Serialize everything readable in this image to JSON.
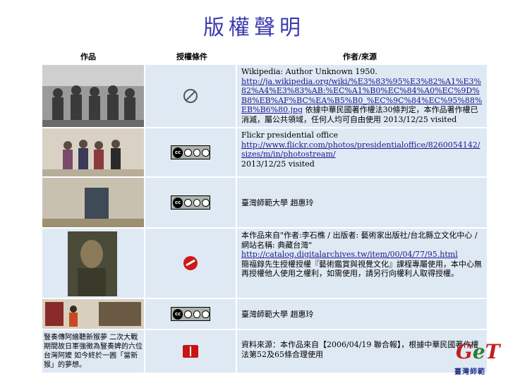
{
  "page": {
    "title": "版權聲明",
    "headers": {
      "work": "作品",
      "license": "授權條件",
      "author": "作者/來源"
    }
  },
  "rows": [
    {
      "license_icon": "public-domain-icon",
      "lines": [
        {
          "text": "Wikipedia: Author Unknown 1950.",
          "link": false
        },
        {
          "text": "http://ja.wikipedia.org/wiki/%E3%83%95%E3%82%A1%E3%82%A4%E3%83%AB:%EC%A1%B0%EC%84%A0%EC%9D%B8%EB%AF%BC%EA%B5%B0_%EC%9C%84%EC%95%88%EB%B6%80.jpg",
          "link": true
        },
        {
          "text": " 依據中華民國著作權法30條判定，本作品著作權已消滅，屬公共領域，任何人均可自由使用 2013/12/25 visited",
          "link": false
        }
      ]
    },
    {
      "license_icon": "cc-by-nc-sa-icon",
      "lines": [
        {
          "text": "Flickr presidential office",
          "link": false
        },
        {
          "text": "http://www.flickr.com/photos/presidentialoffice/8260054142/sizes/m/in/photostream/",
          "link": true
        },
        {
          "text": "2013/12/25 visited",
          "link": false
        }
      ]
    },
    {
      "license_icon": "cc-by-nc-sa-icon",
      "lines": [
        {
          "text": "臺灣師範大學 趙惠玲",
          "link": false
        }
      ]
    },
    {
      "license_icon": "restricted-icon",
      "lines": [
        {
          "text": "本作品來自\"作者:李石樵 / 出版者: 藝術家出版社/台北縣立文化中心 / 網站名稱: 典藏台灣\"",
          "link": false
        },
        {
          "text": "http://catalog.digitalarchives.tw/item/00/04/77/95.html",
          "link": true
        },
        {
          "text": "簡福錞先生授權授權『藝術鑑賞與視覺文化』課程專屬使用，本中心無再授權他人使用之權利，如需使用，請另行向權利人取得授權。",
          "link": false
        }
      ]
    },
    {
      "license_icon": "cc-by-nc-sa-icon",
      "lines": [
        {
          "text": "臺灣師範大學 趙惠玲",
          "link": false
        }
      ]
    },
    {
      "license_icon": "news-source-icon",
      "work_text": "豎奏傳阿繪聽新猴夢 二次大戰期間故日軍強徵為豎奏婢的六位台灣阿嬤 如今終於一圓「當新猴」的夢想。",
      "lines": [
        {
          "text": "資料來源：本作品來自【2006/04/19 聯合報】，根據中華民國著作權法第52及65條合理使用",
          "link": false
        }
      ]
    }
  ],
  "logo": {
    "text_g": "G",
    "text_e": "e",
    "text_t": "T",
    "org": "臺灣師範"
  }
}
